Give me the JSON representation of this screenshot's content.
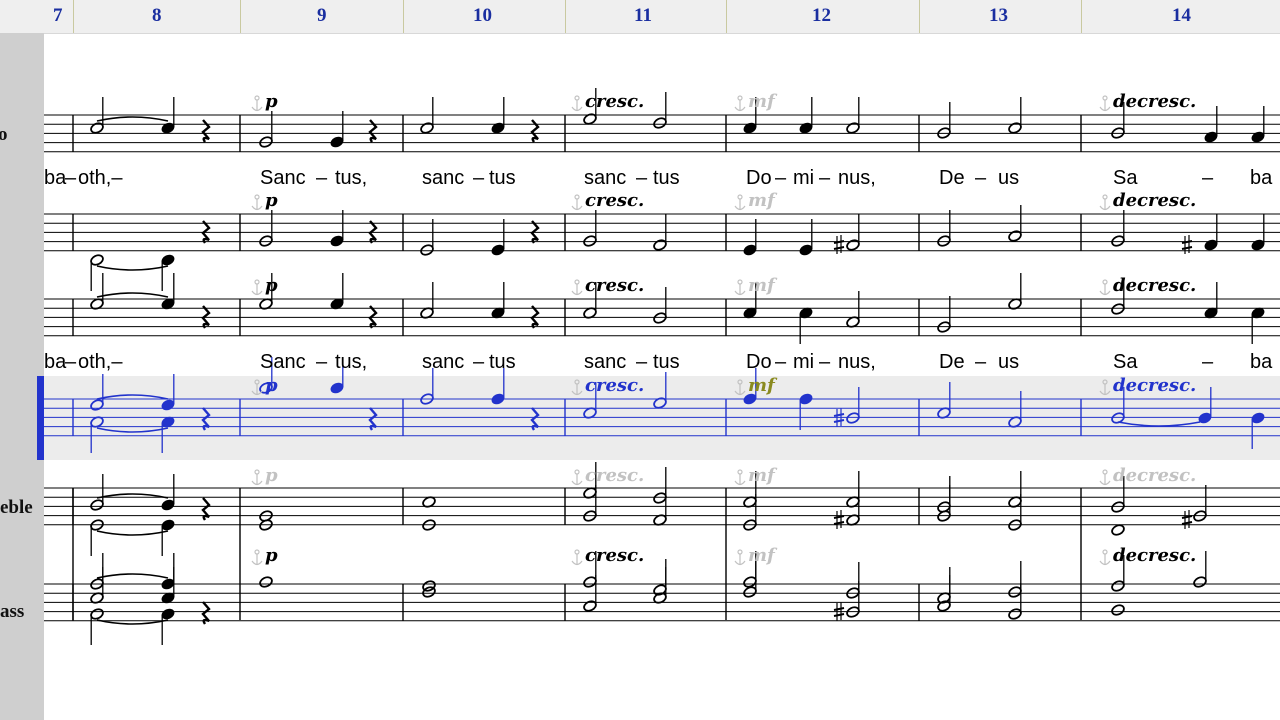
{
  "ruler": {
    "measures": [
      "7",
      "8",
      "9",
      "10",
      "11",
      "12",
      "13",
      "14"
    ]
  },
  "gutter": {
    "labels": [
      "o",
      "eble",
      "ass"
    ]
  },
  "lyrics": {
    "line1": [
      "ba",
      "–",
      "oth,–",
      "Sanc",
      "–",
      "tus,",
      "sanc",
      "–",
      "tus",
      "sanc",
      "–",
      "tus",
      "Do",
      "–",
      "mi",
      "–",
      "nus,",
      "De",
      "–",
      "us",
      "Sa",
      "–",
      "ba"
    ],
    "line2": [
      "ba",
      "–",
      "oth,–",
      "Sanc",
      "–",
      "tus,",
      "sanc",
      "–",
      "tus",
      "sanc",
      "–",
      "tus",
      "Do",
      "–",
      "mi",
      "–",
      "nus,",
      "De",
      "–",
      "us",
      "Sa",
      "–",
      "ba"
    ]
  },
  "dynamics": {
    "p": "p",
    "cresc": "cresc.",
    "mf": "mf",
    "decresc": "decresc."
  },
  "colors": {
    "selected_staff": "#2233cc",
    "selected_band": "#ececec",
    "ghost": "#c2c2c2",
    "anchor_olive": "#8a8a20",
    "measure_number": "#1a2ea0"
  },
  "selection": {
    "staff": 4
  }
}
